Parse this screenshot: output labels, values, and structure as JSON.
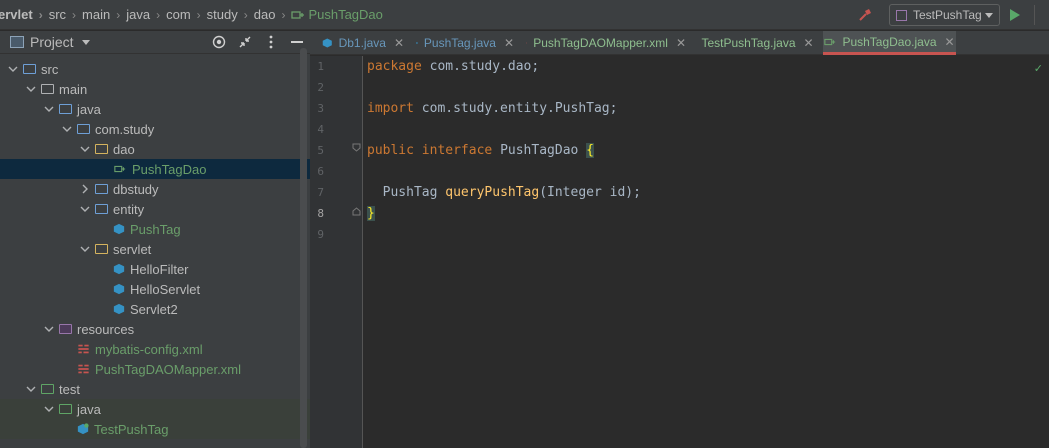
{
  "breadcrumb": [
    "ervlet",
    "src",
    "main",
    "java",
    "com",
    "study",
    "dao",
    "PushTagDao"
  ],
  "run_config": {
    "label": "TestPushTag"
  },
  "project_panel": {
    "title": "Project",
    "tree": [
      {
        "label": "src",
        "indent": 1,
        "expanded": true,
        "icon": "src-folder-icon",
        "color": "normal"
      },
      {
        "label": "main",
        "indent": 2,
        "expanded": true,
        "icon": "folder-icon",
        "color": "normal"
      },
      {
        "label": "java",
        "indent": 3,
        "expanded": true,
        "icon": "source-folder-icon",
        "color": "normal"
      },
      {
        "label": "com.study",
        "indent": 4,
        "expanded": true,
        "icon": "package-icon",
        "color": "normal"
      },
      {
        "label": "dao",
        "indent": 5,
        "expanded": true,
        "icon": "yellow-folder-icon",
        "color": "normal"
      },
      {
        "label": "PushTagDao",
        "indent": 6,
        "leaf": true,
        "icon": "interface-icon",
        "color": "green",
        "selected": true
      },
      {
        "label": "dbstudy",
        "indent": 5,
        "expanded": false,
        "icon": "package-icon",
        "color": "normal"
      },
      {
        "label": "entity",
        "indent": 5,
        "expanded": true,
        "icon": "package-icon",
        "color": "normal"
      },
      {
        "label": "PushTag",
        "indent": 6,
        "leaf": true,
        "icon": "class-icon",
        "color": "green"
      },
      {
        "label": "servlet",
        "indent": 5,
        "expanded": true,
        "icon": "yellow-folder-icon",
        "color": "normal"
      },
      {
        "label": "HelloFilter",
        "indent": 6,
        "leaf": true,
        "icon": "class-icon",
        "color": "normal"
      },
      {
        "label": "HelloServlet",
        "indent": 6,
        "leaf": true,
        "icon": "class-icon",
        "color": "normal"
      },
      {
        "label": "Servlet2",
        "indent": 6,
        "leaf": true,
        "icon": "class-icon",
        "color": "normal"
      },
      {
        "label": "resources",
        "indent": 3,
        "expanded": true,
        "icon": "resources-folder-icon",
        "color": "normal"
      },
      {
        "label": "mybatis-config.xml",
        "indent": 4,
        "leaf": true,
        "icon": "xml-icon",
        "color": "green"
      },
      {
        "label": "PushTagDAOMapper.xml",
        "indent": 4,
        "leaf": true,
        "icon": "xml-icon",
        "color": "green"
      },
      {
        "label": "test",
        "indent": 2,
        "expanded": true,
        "icon": "test-folder-icon",
        "color": "normal"
      },
      {
        "label": "java",
        "indent": 3,
        "expanded": true,
        "icon": "test-source-folder-icon",
        "color": "normal",
        "highlight": true
      },
      {
        "label": "TestPushTag",
        "indent": 4,
        "leaf": true,
        "icon": "test-class-icon",
        "color": "green",
        "highlight": true
      }
    ]
  },
  "tabs": [
    {
      "label": "Db1.java",
      "icon": "class-icon",
      "color": "blue"
    },
    {
      "label": "PushTag.java",
      "icon": "class-icon",
      "color": "blue"
    },
    {
      "label": "PushTagDAOMapper.xml",
      "icon": "xml-icon",
      "color": "green"
    },
    {
      "label": "TestPushTag.java",
      "icon": "test-class-icon",
      "color": "green"
    },
    {
      "label": "PushTagDao.java",
      "icon": "interface-icon",
      "color": "green",
      "active": true
    }
  ],
  "editor": {
    "line_numbers": [
      "1",
      "2",
      "3",
      "4",
      "5",
      "6",
      "7",
      "8",
      "9"
    ],
    "current_line": "8",
    "code": {
      "l1_kw": "package",
      "l1_rest": " com.study.dao;",
      "l3_kw": "import",
      "l3_rest": " com.study.entity.PushTag;",
      "l5_kw1": "public",
      "l5_kw2": "interface",
      "l5_rest": " PushTagDao ",
      "l5_brace": "{",
      "l7_type": "  PushTag ",
      "l7_fn": "queryPushTag",
      "l7_rest": "(Integer id);",
      "l8_brace": "}"
    }
  },
  "colors": {
    "accent_tab": "#c75450",
    "keyword": "#cc7832",
    "method": "#ffc66d",
    "selection": "#0d293e"
  }
}
